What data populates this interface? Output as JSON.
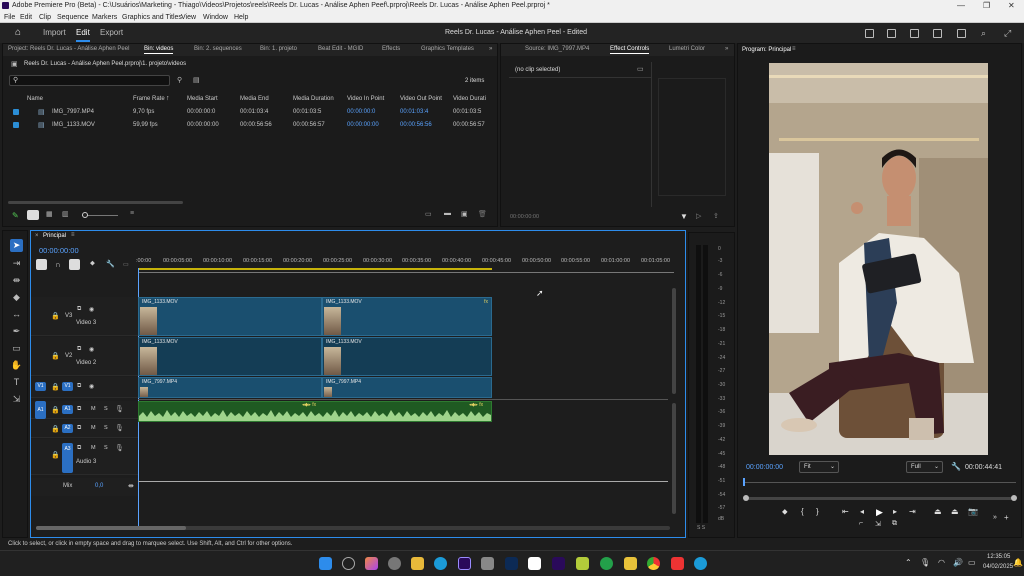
{
  "window": {
    "title": "Adobe Premiere Pro (Beta) - C:\\Usuários\\Marketing - Thiago\\Videos\\Projetos\\reels\\Reels Dr. Lucas - Análise Aphen Peef\\.prproj\\Reels Dr. Lucas - Análise Aphen Peel.prproj *"
  },
  "menu": [
    "File",
    "Edit",
    "Clip",
    "Sequence",
    "Markers",
    "Graphics and Titles",
    "View",
    "Window",
    "Help"
  ],
  "workspaces": {
    "import": "Import",
    "edit": "Edit",
    "export": "Export"
  },
  "document": {
    "name": "Reels Dr. Lucas - Análise Aphen Peel - Edited"
  },
  "project_panel": {
    "tabs": [
      "Project: Reels Dr. Lucas - Análise Aphen Peel",
      "Bin: videos",
      "Bin: 2. sequences",
      "Bin: 1. projeto",
      "Beat Edit - MGID",
      "Effects",
      "Graphics Templates"
    ],
    "path": "Reels Dr. Lucas - Análise Aphen Peel.prproj\\1. projeto\\videos",
    "item_count": "2 items",
    "columns": [
      "Name",
      "Frame Rate",
      "Media Start",
      "Media End",
      "Media Duration",
      "Video In Point",
      "Video Out Point",
      "Video Durati"
    ],
    "rows": [
      {
        "name": "IMG_7997.MP4",
        "fps": "9,70 fps",
        "start": "00:00:00:0",
        "end": "00:01:03:4",
        "dur": "00:01:03:5",
        "vin": "00:00:00:0",
        "vout": "00:01:03:4",
        "vdur": "00:01:03:5"
      },
      {
        "name": "IMG_1133.MOV",
        "fps": "59,99 fps",
        "start": "00:00:00:00",
        "end": "00:00:56:56",
        "dur": "00:00:56:57",
        "vin": "00:00:00:00",
        "vout": "00:00:56:56",
        "vdur": "00:00:56:57"
      }
    ]
  },
  "source_panel": {
    "tabs": [
      "Source: IMG_7997.MP4",
      "Effect Controls",
      "Lumetri Color"
    ],
    "no_clip": "(no clip selected)",
    "timecode": "00:00:00:00"
  },
  "program": {
    "title": "Program: Principal",
    "timecode": "00:00:00:00",
    "fit": "Fit",
    "quality": "Full",
    "duration": "00:00:44:41"
  },
  "timeline": {
    "tab": "Principal",
    "timecode": "00:00:00:00",
    "ruler": [
      ":00:00",
      "00:00:05:00",
      "00:00:10:00",
      "00:00:15:00",
      "00:00:20:00",
      "00:00:25:00",
      "00:00:30:00",
      "00:00:35:00",
      "00:00:40:00",
      "00:00:45:00",
      "00:00:50:00",
      "00:00:55:00",
      "00:01:00:00",
      "00:01:05:00"
    ],
    "tracks": {
      "v3": "V3",
      "v3name": "Video 3",
      "v2": "V2",
      "v2name": "Video 2",
      "v1": "V1",
      "a1": "A1",
      "a2": "A2",
      "a3": "A3",
      "a3name": "Audio 3",
      "mix": "Mix",
      "mixval": "0,0",
      "src_v": "V1",
      "src_a": "A1"
    },
    "clips": {
      "c1": "IMG_1133.MOV",
      "c2": "IMG_1133.MOV",
      "c3": "IMG_1133.MOV",
      "c4": "IMG_1133.MOV",
      "c5": "IMG_7997.MP4",
      "c6": "IMG_7997.MP4"
    }
  },
  "meter": [
    "0",
    "-3",
    "-6",
    "-9",
    "-12",
    "-15",
    "-18",
    "-21",
    "-24",
    "-27",
    "-30",
    "-33",
    "-36",
    "-39",
    "-42",
    "-45",
    "-48",
    "-51",
    "-54",
    "-57",
    "dB"
  ],
  "meter_solo": "S S",
  "status": "Click to select, or click in empty space and drag to marquee select. Use Shift, Alt, and Ctrl for other options.",
  "clock": {
    "time": "12:35:05",
    "date": "04/02/2025"
  },
  "colors": {
    "accent": "#2d8ceb",
    "video_clip": "#1a4f6f",
    "audio_clip": "#1f5a22",
    "playhead": "#5aa3ff"
  }
}
